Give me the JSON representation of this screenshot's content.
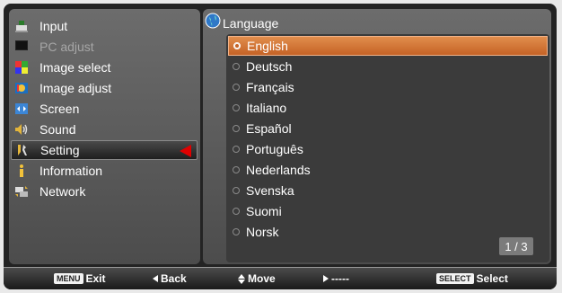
{
  "menu": {
    "items": [
      {
        "label": "Input",
        "icon": "input-icon",
        "state": "normal"
      },
      {
        "label": "PC adjust",
        "icon": "pc-adjust-icon",
        "state": "disabled"
      },
      {
        "label": "Image select",
        "icon": "image-select-icon",
        "state": "normal"
      },
      {
        "label": "Image adjust",
        "icon": "image-adjust-icon",
        "state": "normal"
      },
      {
        "label": "Screen",
        "icon": "screen-icon",
        "state": "normal"
      },
      {
        "label": "Sound",
        "icon": "sound-icon",
        "state": "normal"
      },
      {
        "label": "Setting",
        "icon": "setting-icon",
        "state": "selected"
      },
      {
        "label": "Information",
        "icon": "information-icon",
        "state": "normal"
      },
      {
        "label": "Network",
        "icon": "network-icon",
        "state": "normal"
      }
    ]
  },
  "language": {
    "title": "Language",
    "options": [
      "English",
      "Deutsch",
      "Français",
      "Italiano",
      "Español",
      "Português",
      "Nederlands",
      "Svenska",
      "Suomi",
      "Norsk"
    ],
    "selected": "English",
    "page": "1 / 3"
  },
  "bottom_bar": {
    "exit": {
      "key": "MENU",
      "label": "Exit"
    },
    "back": {
      "label": "Back"
    },
    "move": {
      "label": "Move"
    },
    "right": {
      "label": "-----"
    },
    "select": {
      "key": "SELECT",
      "label": "Select"
    }
  },
  "colors": {
    "highlight": "#d7793a",
    "pointer": "#e00000",
    "panel": "#5c5c5c"
  }
}
